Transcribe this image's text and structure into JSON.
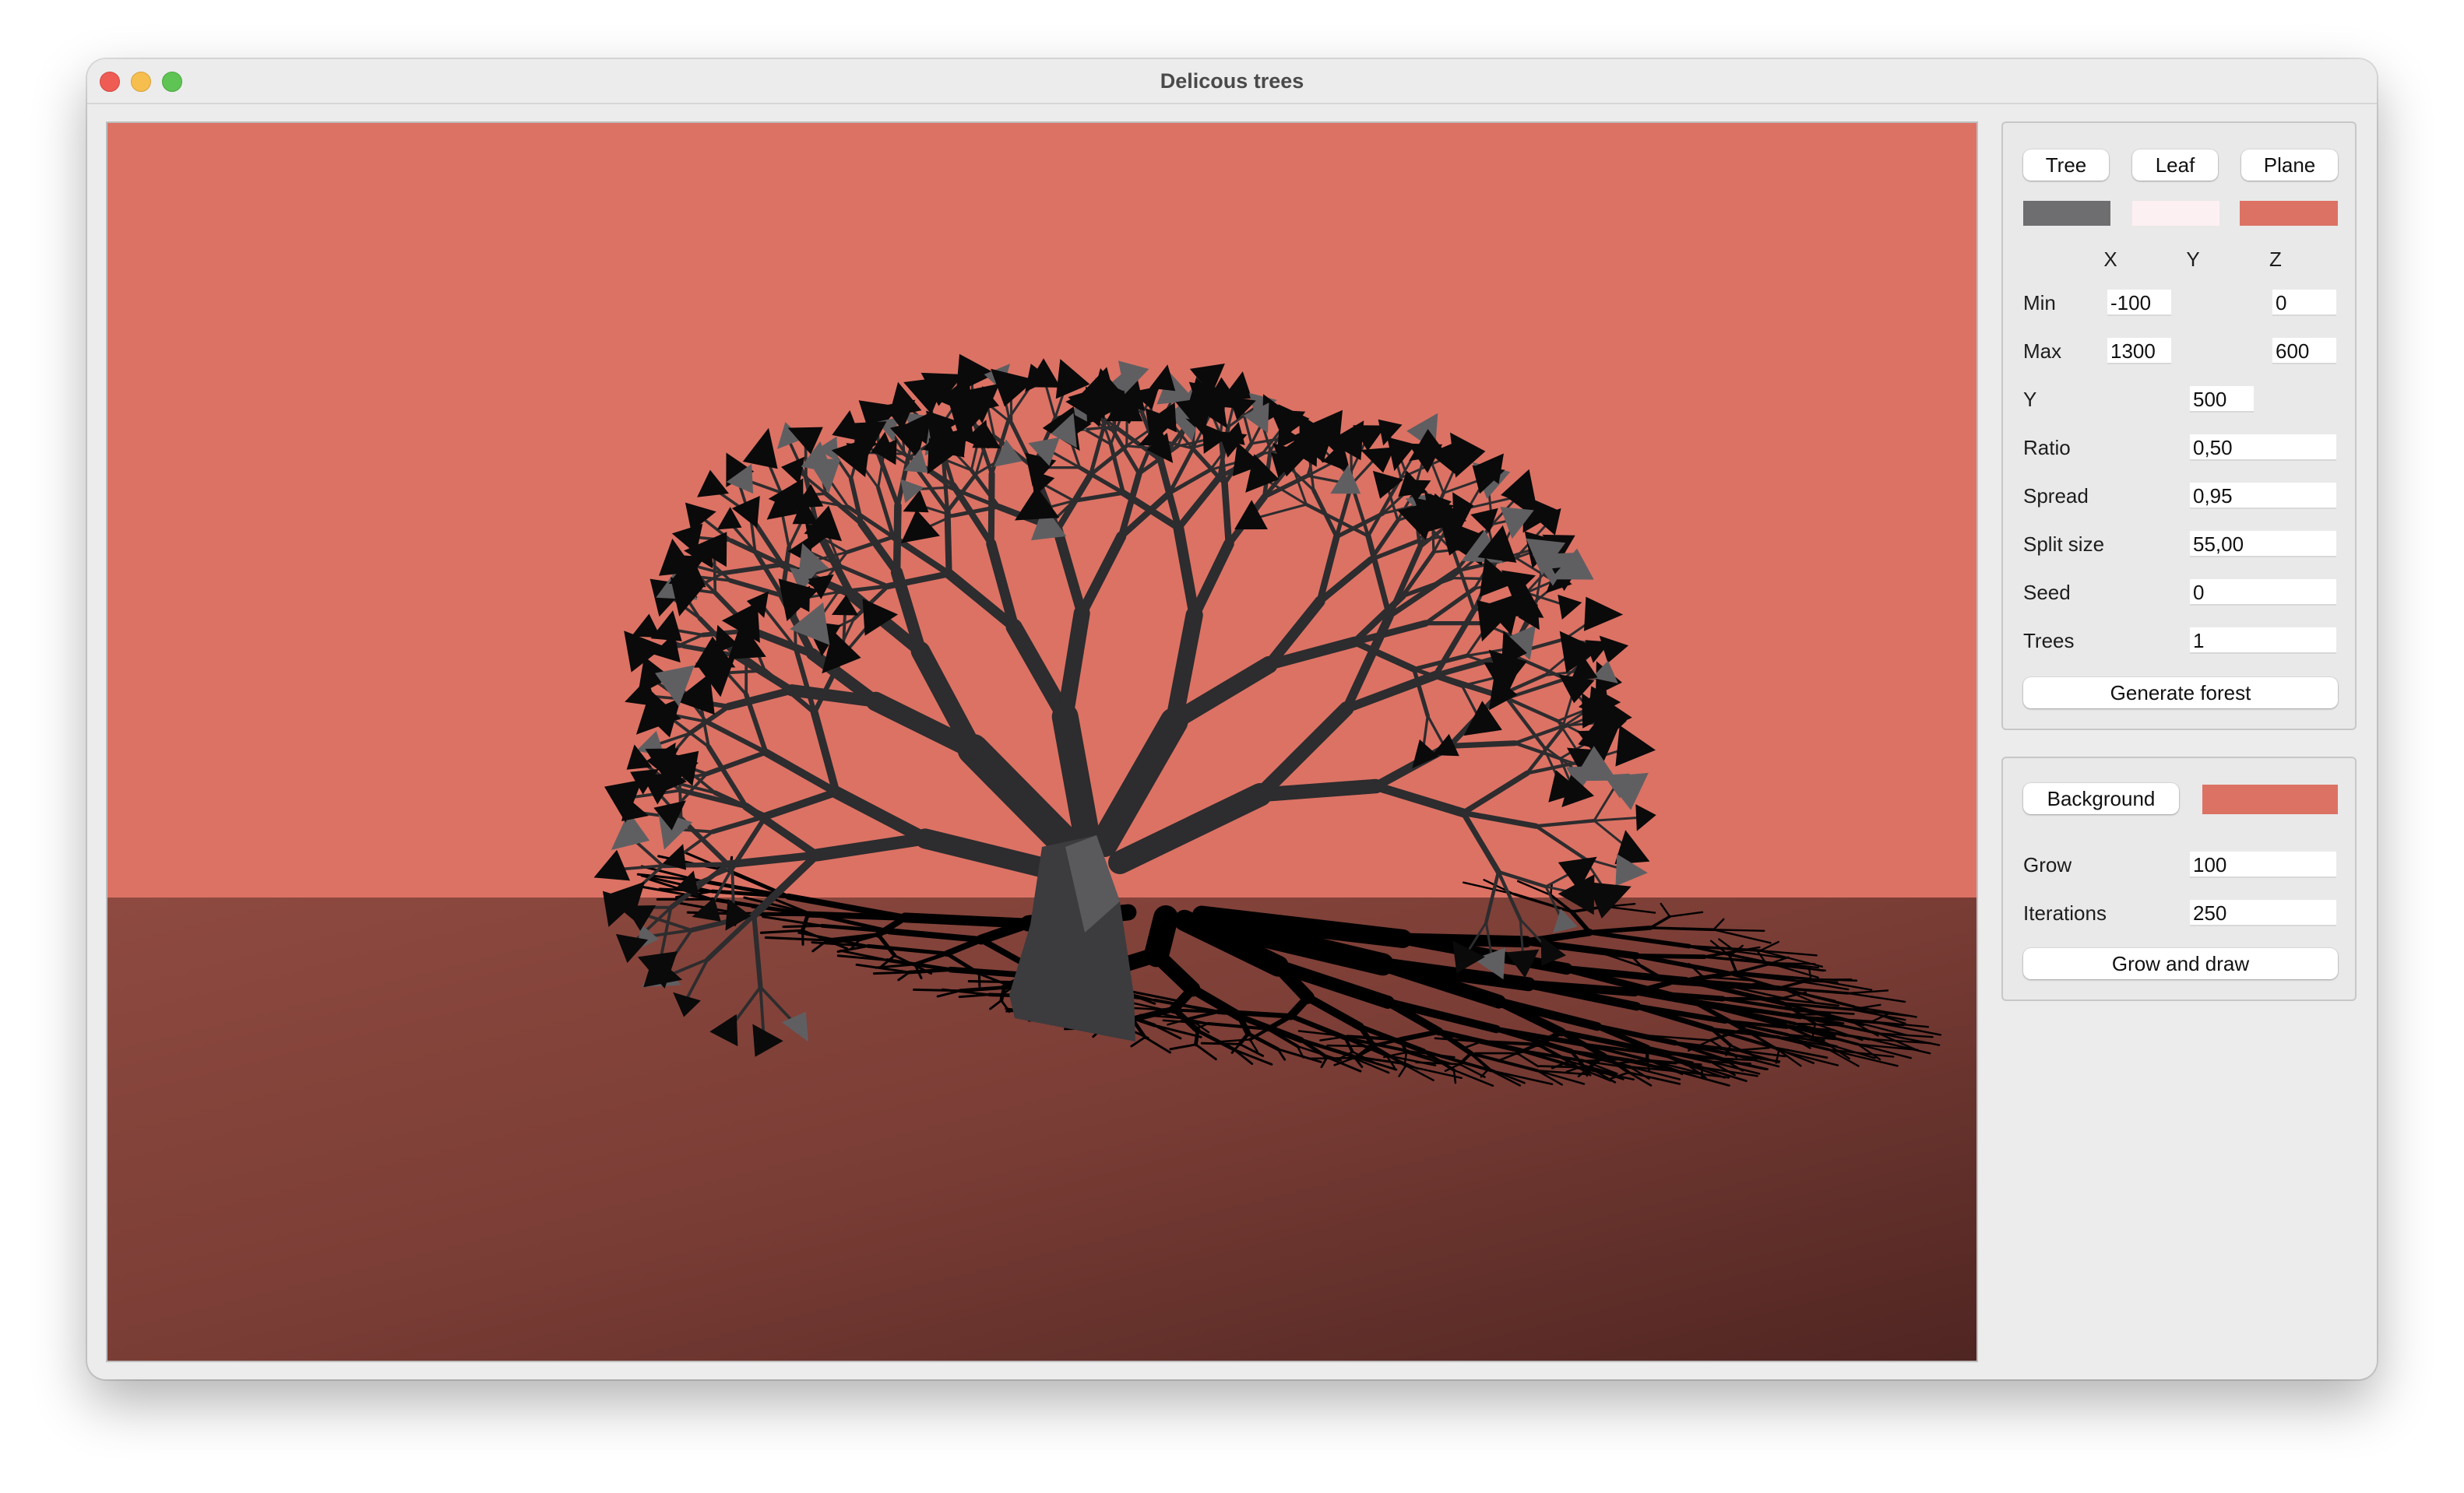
{
  "window": {
    "title": "Delicous trees"
  },
  "colors": {
    "tree": "#6e6d70",
    "leaf": "#fdf0f2",
    "plane": "#dc7264",
    "background": "#dc7264",
    "ground": "#8a4a40"
  },
  "viewport": {
    "description_icon": "3d-render-canvas"
  },
  "tree_panel": {
    "tree_button": "Tree",
    "leaf_button": "Leaf",
    "plane_button": "Plane",
    "axis_x": "X",
    "axis_y": "Y",
    "axis_z": "Z",
    "min_label": "Min",
    "min_x": "-100",
    "min_z": "0",
    "max_label": "Max",
    "max_x": "1300",
    "max_z": "600",
    "y_label": "Y",
    "y_value": "500",
    "ratio_label": "Ratio",
    "ratio_value": "0,50",
    "spread_label": "Spread",
    "spread_value": "0,95",
    "split_label": "Split size",
    "split_value": "55,00",
    "seed_label": "Seed",
    "seed_value": "0",
    "trees_label": "Trees",
    "trees_value": "1",
    "generate_button": "Generate forest"
  },
  "grow_panel": {
    "background_button": "Background",
    "grow_label": "Grow",
    "grow_value": "100",
    "iterations_label": "Iterations",
    "iterations_value": "250",
    "grow_button": "Grow and draw"
  }
}
